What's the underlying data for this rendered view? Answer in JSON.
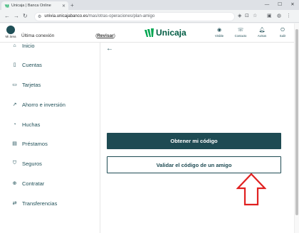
{
  "browser": {
    "tab_title": "Unicaja | Banca Online",
    "url_host": "univia.unicajabanco.es",
    "url_path": "/mas/otras-operaciones/plan-amigo",
    "tab_close": "✕",
    "new_tab": "+"
  },
  "header": {
    "area_label": "Mi área",
    "last_connection_label": "Última conexión",
    "revisar_label": "Revisar",
    "brand": "Unicaja",
    "icons": [
      {
        "name": "visible-icon",
        "glyph": "◉",
        "label": "Visible"
      },
      {
        "name": "contacto-icon",
        "glyph": "☏",
        "label": "Contacto"
      },
      {
        "name": "avisos-icon",
        "glyph": "🔔︎",
        "label": "Avisos"
      },
      {
        "name": "salir-icon",
        "glyph": "⏻",
        "label": "Salir"
      }
    ]
  },
  "sidebar": {
    "items": [
      {
        "name": "sidebar-item-inicio",
        "icon": "home-icon",
        "glyph": "⌂",
        "label": "Inicio"
      },
      {
        "name": "sidebar-item-cuentas",
        "icon": "accounts-icon",
        "glyph": "▯",
        "label": "Cuentas"
      },
      {
        "name": "sidebar-item-tarjetas",
        "icon": "card-icon",
        "glyph": "▭",
        "label": "Tarjetas"
      },
      {
        "name": "sidebar-item-ahorro",
        "icon": "chart-line-icon",
        "glyph": "↗",
        "label": "Ahorro e inversión"
      },
      {
        "name": "sidebar-item-huchas",
        "icon": "piggy-bank-icon",
        "glyph": "◔",
        "label": "Huchas"
      },
      {
        "name": "sidebar-item-prestamos",
        "icon": "loan-icon",
        "glyph": "▤",
        "label": "Préstamos"
      },
      {
        "name": "sidebar-item-seguros",
        "icon": "shield-icon",
        "glyph": "⛉",
        "label": "Seguros"
      },
      {
        "name": "sidebar-item-contratar",
        "icon": "plus-circle-icon",
        "glyph": "⊕",
        "label": "Contratar"
      },
      {
        "name": "sidebar-item-transferencias",
        "icon": "transfer-icon",
        "glyph": "⇄",
        "label": "Transferencias"
      }
    ]
  },
  "main": {
    "obtener_label": "Obtener mi código",
    "validar_label": "Validar el código de un amigo"
  },
  "colors": {
    "brand_green": "#005c43",
    "primary": "#1e4b53",
    "annotation_red": "#e02020"
  }
}
